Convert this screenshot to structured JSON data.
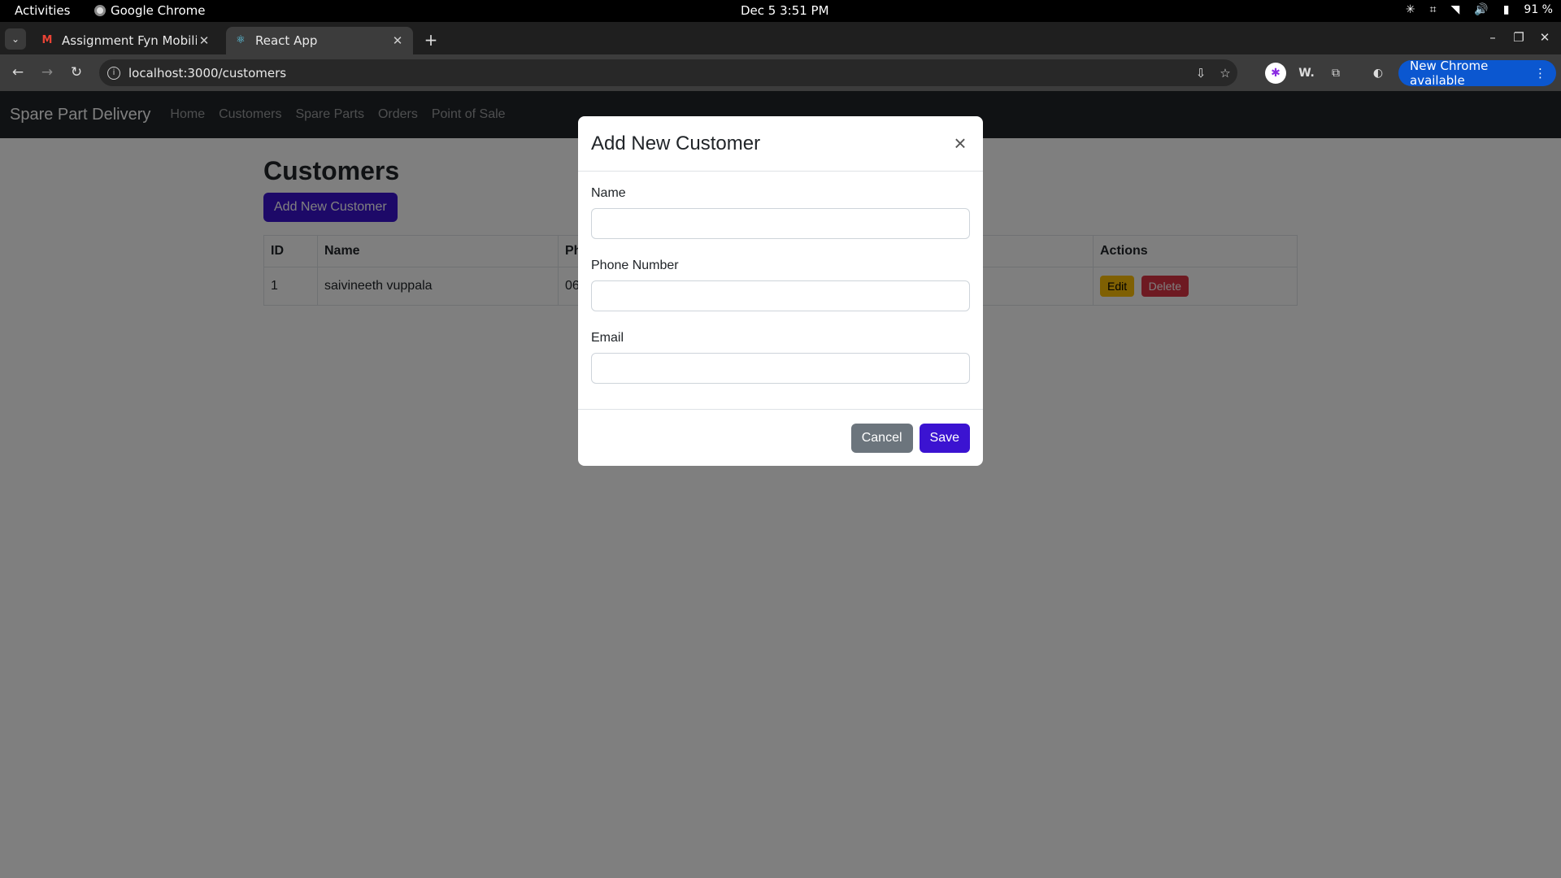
{
  "os": {
    "activities": "Activities",
    "app_name": "Google Chrome",
    "clock": "Dec 5  3:51 PM",
    "battery": "91 %"
  },
  "browser": {
    "tabs": [
      {
        "title": "Assignment Fyn Mobility",
        "icon": "gmail-icon",
        "active": false
      },
      {
        "title": "React App",
        "icon": "react-icon",
        "active": true
      }
    ],
    "url": "localhost:3000/customers",
    "update_label": "New Chrome available",
    "ext_w_label": "W."
  },
  "app": {
    "brand": "Spare Part Delivery",
    "nav": [
      "Home",
      "Customers",
      "Spare Parts",
      "Orders",
      "Point of Sale"
    ]
  },
  "page": {
    "title": "Customers",
    "add_button": "Add New Customer",
    "table": {
      "headers": [
        "ID",
        "Name",
        "Ph",
        "Actions"
      ],
      "rows": [
        {
          "id": "1",
          "name": "saivineeth vuppala",
          "phone": "06",
          "edit": "Edit",
          "delete": "Delete"
        }
      ]
    }
  },
  "modal": {
    "title": "Add New Customer",
    "fields": [
      {
        "label": "Name",
        "value": ""
      },
      {
        "label": "Phone Number",
        "value": ""
      },
      {
        "label": "Email",
        "value": ""
      }
    ],
    "cancel": "Cancel",
    "save": "Save"
  }
}
